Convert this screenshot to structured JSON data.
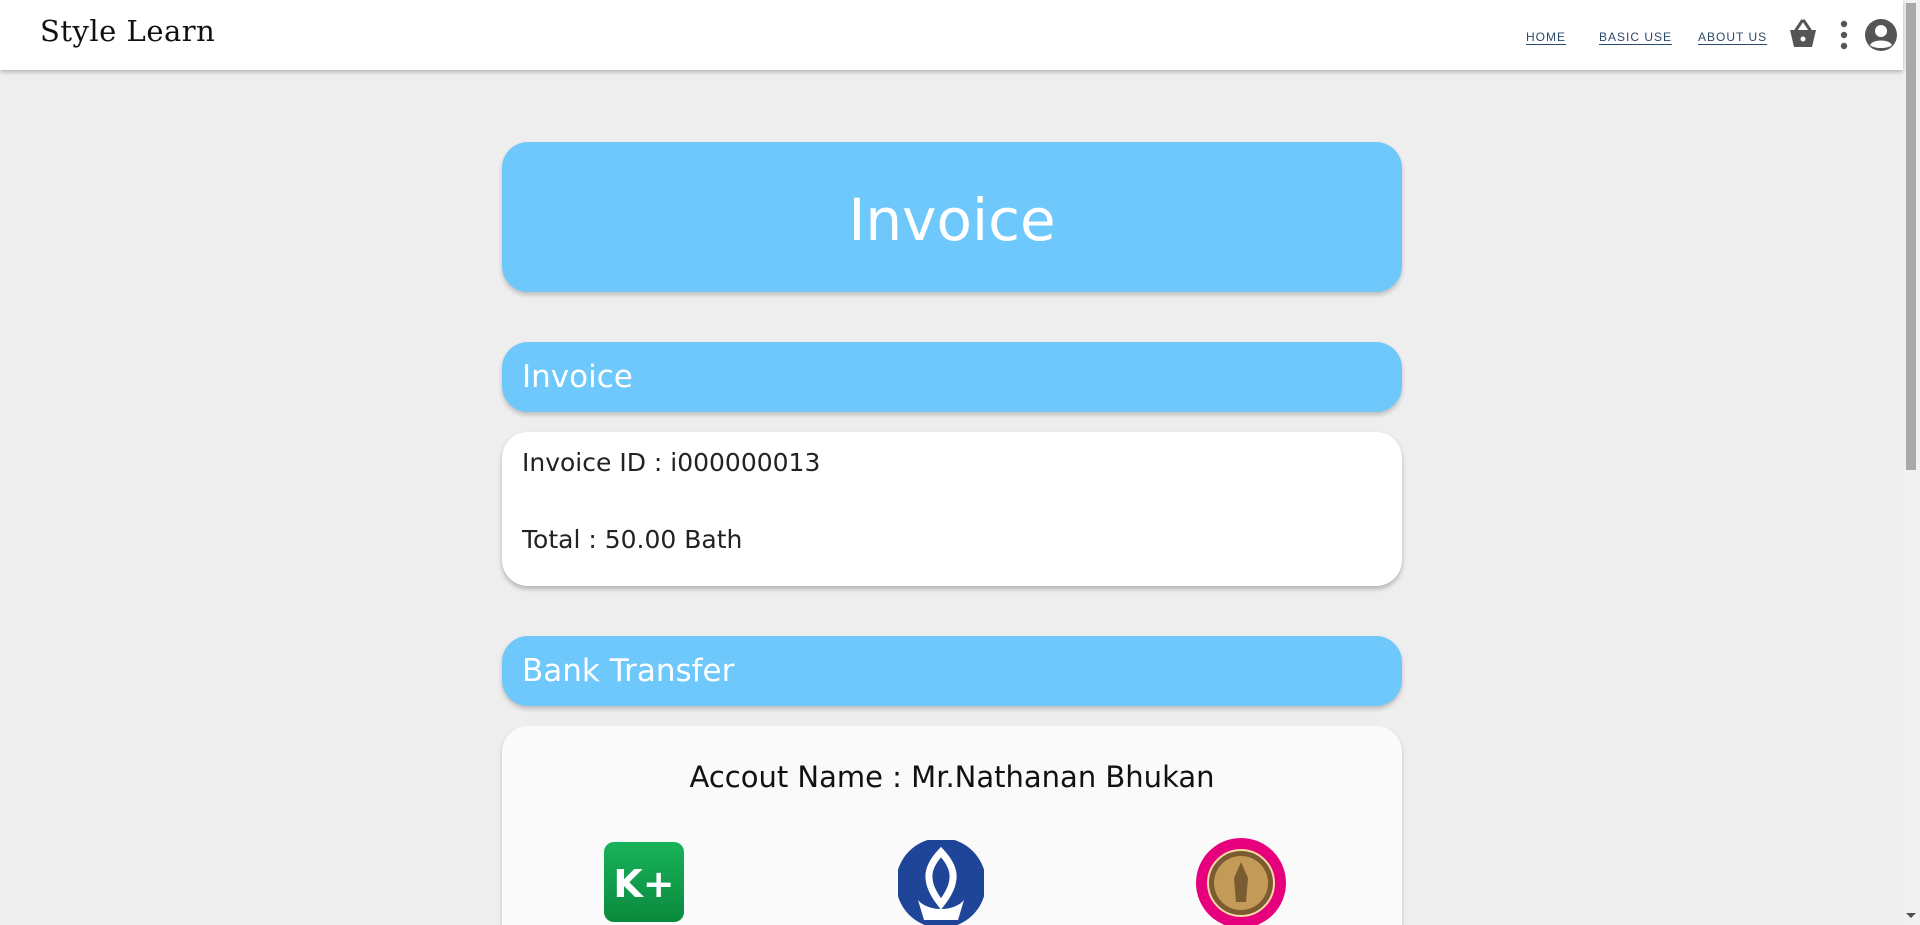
{
  "navbar": {
    "logo_text": "Style Learn",
    "links": [
      "HOME",
      "BASIC USE",
      "ABOUT US"
    ],
    "icons": [
      "basket-icon",
      "more-vert-icon",
      "account-icon"
    ]
  },
  "hero": {
    "title": "Invoice"
  },
  "invoice_section": {
    "heading": "Invoice",
    "invoice_id": "Invoice ID : i000000013",
    "total": "Total : 50.00 Bath"
  },
  "bank_section": {
    "heading": "Bank Transfer",
    "account_name": "Accout Name : Mr.Nathanan Bhukan",
    "banks": [
      {
        "name": "kplus-logo",
        "logo_text": "K+",
        "color": "#0f9d48"
      },
      {
        "name": "bangkok-bank-logo",
        "color": "#1e4598"
      },
      {
        "name": "gsb-bank-logo",
        "color": "#e6007e"
      }
    ]
  },
  "colors": {
    "accent": "#6fc8fb",
    "background": "#eeeeee",
    "card": "#ffffff"
  }
}
